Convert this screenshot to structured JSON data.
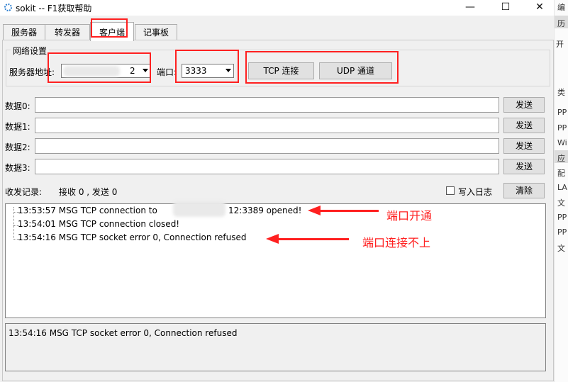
{
  "window": {
    "title": "sokit -- F1获取帮助",
    "controls": {
      "minimize": "—",
      "maximize": "☐",
      "close": "✕"
    }
  },
  "tabs": [
    {
      "label": "服务器"
    },
    {
      "label": "转发器"
    },
    {
      "label": "客户端",
      "active": true
    },
    {
      "label": "记事板"
    }
  ],
  "network": {
    "group_title": "网络设置",
    "server_label": "服务器地址:",
    "server_value": "2",
    "port_label": "端口:",
    "port_value": "3333",
    "tcp_button": "TCP 连接",
    "udp_button": "UDP 通道"
  },
  "data_rows": [
    {
      "label": "数据0:",
      "value": "",
      "send": "发送"
    },
    {
      "label": "数据1:",
      "value": "",
      "send": "发送"
    },
    {
      "label": "数据2:",
      "value": "",
      "send": "发送"
    },
    {
      "label": "数据3:",
      "value": "",
      "send": "发送"
    }
  ],
  "records": {
    "label": "收发记录:",
    "stats": "接收 0 , 发送 0",
    "write_log_label": "写入日志",
    "write_log_checked": false,
    "clear_button": "清除"
  },
  "log": {
    "lines": [
      {
        "prefix": "13:53:57 MSG TCP connection to",
        "suffix": "12:3389 opened!"
      },
      {
        "text": "13:54:01 MSG TCP connection closed!"
      },
      {
        "text": "13:54:16 MSG TCP socket error 0, Connection refused"
      }
    ]
  },
  "status_text": "13:54:16 MSG TCP socket error 0, Connection refused",
  "annotations": {
    "opened": "端口开通",
    "refused": "端口连接不上"
  },
  "sidebar": {
    "items": [
      "编",
      "历",
      "开",
      "类",
      "PP",
      "PP",
      "Wi",
      "应",
      "配",
      "LA",
      "文",
      "PP",
      "PP",
      "文"
    ]
  },
  "colors": {
    "highlight_red": "#ff2020",
    "window_bg": "#f0f0f0"
  }
}
